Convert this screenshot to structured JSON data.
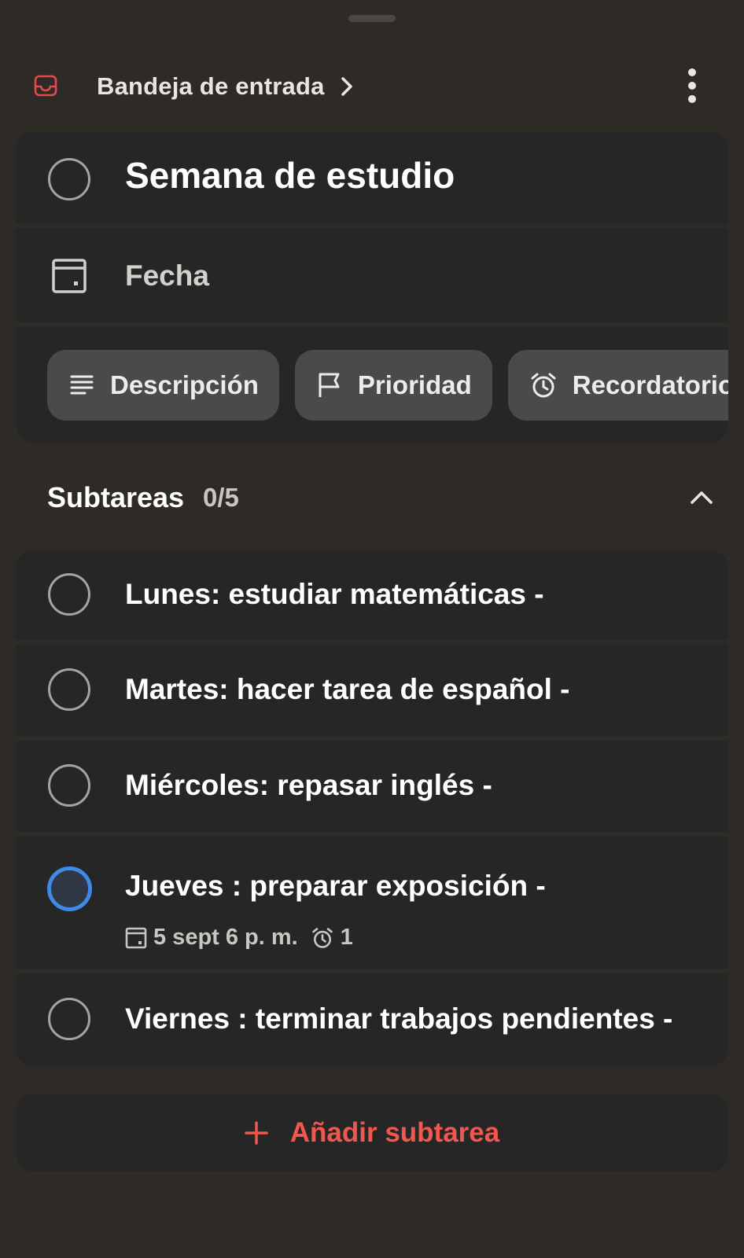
{
  "header": {
    "breadcrumb": "Bandeja de entrada",
    "inbox_icon": "inbox-icon",
    "more_icon": "more-vertical-icon"
  },
  "task": {
    "title": "Semana de estudio",
    "date_label": "Fecha"
  },
  "chips": [
    {
      "label": "Descripción",
      "icon": "description-icon"
    },
    {
      "label": "Prioridad",
      "icon": "flag-icon"
    },
    {
      "label": "Recordatorios",
      "icon": "alarm-icon"
    }
  ],
  "subtasks": {
    "title": "Subtareas",
    "count": "0/5",
    "items": [
      {
        "label": "Lunes: estudiar matemáticas -"
      },
      {
        "label": "Martes: hacer tarea de español -"
      },
      {
        "label": "Miércoles: repasar inglés -"
      },
      {
        "label": "Jueves : preparar exposición -",
        "date": "5 sept 6 p. m.",
        "reminders": "1"
      },
      {
        "label": "Viernes : terminar trabajos pendientes -"
      }
    ],
    "add_label": "Añadir subtarea"
  },
  "colors": {
    "background": "#2e2a25",
    "card": "#262626",
    "accent_red": "#f0574e",
    "accent_blue": "#3f8ae6"
  }
}
